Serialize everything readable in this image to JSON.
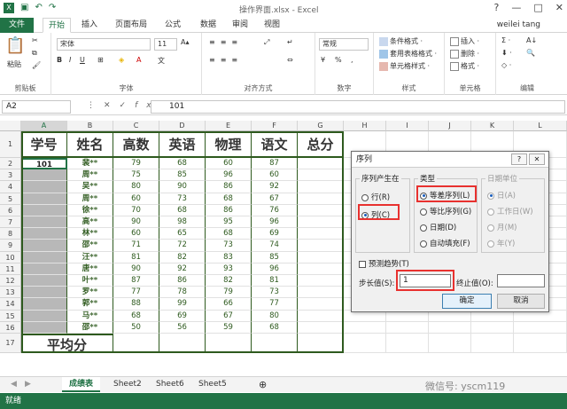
{
  "window": {
    "title": "操作界面.xlsx - Excel",
    "user": "weilei tang"
  },
  "tabs": [
    "文件",
    "开始",
    "插入",
    "页面布局",
    "公式",
    "数据",
    "审阅",
    "视图"
  ],
  "ribbon": {
    "clipboard": {
      "label": "剪贴板",
      "paste": "粘贴"
    },
    "font": {
      "label": "字体",
      "name": "宋体",
      "size": "11"
    },
    "align": {
      "label": "对齐方式"
    },
    "number": {
      "label": "数字",
      "format": "常规"
    },
    "styles": {
      "label": "样式",
      "items": [
        "条件格式 ·",
        "套用表格格式 ·",
        "单元格样式 ·"
      ]
    },
    "cells": {
      "label": "单元格",
      "items": [
        "插入 ·",
        "删除 ·",
        "格式 ·"
      ]
    },
    "edit": {
      "label": "编辑"
    }
  },
  "formula": {
    "namebox": "A2",
    "fx": "fx",
    "value": "101"
  },
  "columns": [
    "A",
    "B",
    "C",
    "D",
    "E",
    "F",
    "G",
    "H",
    "I",
    "J",
    "K",
    "L"
  ],
  "headers": [
    "学号",
    "姓名",
    "高数",
    "英语",
    "物理",
    "语文",
    "总分"
  ],
  "rows": [
    [
      "101",
      "裴**",
      "79",
      "68",
      "60",
      "87"
    ],
    [
      "",
      "周**",
      "75",
      "85",
      "96",
      "60"
    ],
    [
      "",
      "吴**",
      "80",
      "90",
      "86",
      "92"
    ],
    [
      "",
      "周**",
      "60",
      "73",
      "68",
      "67"
    ],
    [
      "",
      "徐**",
      "70",
      "68",
      "86",
      "76"
    ],
    [
      "",
      "高**",
      "90",
      "98",
      "95",
      "96"
    ],
    [
      "",
      "林**",
      "60",
      "65",
      "68",
      "69"
    ],
    [
      "",
      "邵**",
      "71",
      "72",
      "73",
      "74"
    ],
    [
      "",
      "汪**",
      "81",
      "82",
      "83",
      "85"
    ],
    [
      "",
      "唐**",
      "90",
      "92",
      "93",
      "96"
    ],
    [
      "",
      "叶**",
      "87",
      "86",
      "82",
      "81"
    ],
    [
      "",
      "罗**",
      "77",
      "78",
      "79",
      "73"
    ],
    [
      "",
      "郭**",
      "88",
      "99",
      "66",
      "77"
    ],
    [
      "",
      "马**",
      "68",
      "69",
      "67",
      "80"
    ],
    [
      "",
      "邵**",
      "50",
      "56",
      "59",
      "68"
    ]
  ],
  "footer_label": "平均分",
  "sheets": [
    "成绩表",
    "Sheet2",
    "Sheet6",
    "Sheet5"
  ],
  "status": "就绪",
  "watermark": "微信号: yscm119",
  "dialog": {
    "title": "序列",
    "help": "?",
    "close": "✕",
    "series_in": "序列产生在",
    "row": "行(R)",
    "col": "列(C)",
    "type": "类型",
    "types": [
      "等差序列(L)",
      "等比序列(G)",
      "日期(D)",
      "自动填充(F)"
    ],
    "date_unit": "日期单位",
    "units": [
      "日(A)",
      "工作日(W)",
      "月(M)",
      "年(Y)"
    ],
    "trend": "预测趋势(T)",
    "step_label": "步长值(S):",
    "step_value": "1",
    "stop_label": "终止值(O):",
    "stop_value": "",
    "ok": "确定",
    "cancel": "取消"
  },
  "colors": {
    "accent": "#217346",
    "highlight": "#e8312f",
    "selected_range": "#b8b8b8"
  }
}
